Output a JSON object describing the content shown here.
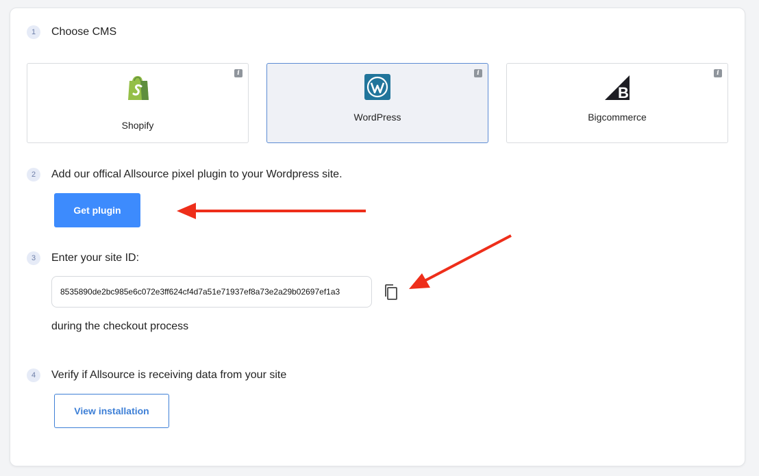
{
  "steps": [
    {
      "number": "1",
      "title": "Choose CMS"
    },
    {
      "number": "2",
      "title": "Add our offical Allsource pixel plugin to your Wordpress site."
    },
    {
      "number": "3",
      "title": "Enter your site ID:"
    },
    {
      "number": "4",
      "title": "Verify if Allsource is receiving data from your site"
    }
  ],
  "cms_options": [
    {
      "label": "Shopify",
      "icon": "shopify-logo-icon",
      "selected": false
    },
    {
      "label": "WordPress",
      "icon": "wordpress-logo-icon",
      "selected": true
    },
    {
      "label": "Bigcommerce",
      "icon": "bigcommerce-logo-icon",
      "selected": false
    }
  ],
  "info_glyph": "i",
  "get_plugin_label": "Get plugin",
  "site_id": "8535890de2bc985e6c072e3ff624cf4d7a51e71937ef8a73e2a29b02697ef1a3",
  "checkout_text": "during the checkout process",
  "view_installation_label": "View installation",
  "colors": {
    "primary": "#3d8bfd",
    "selected_border": "#5b8bd3",
    "annotation_arrow": "#ee2e1a"
  }
}
